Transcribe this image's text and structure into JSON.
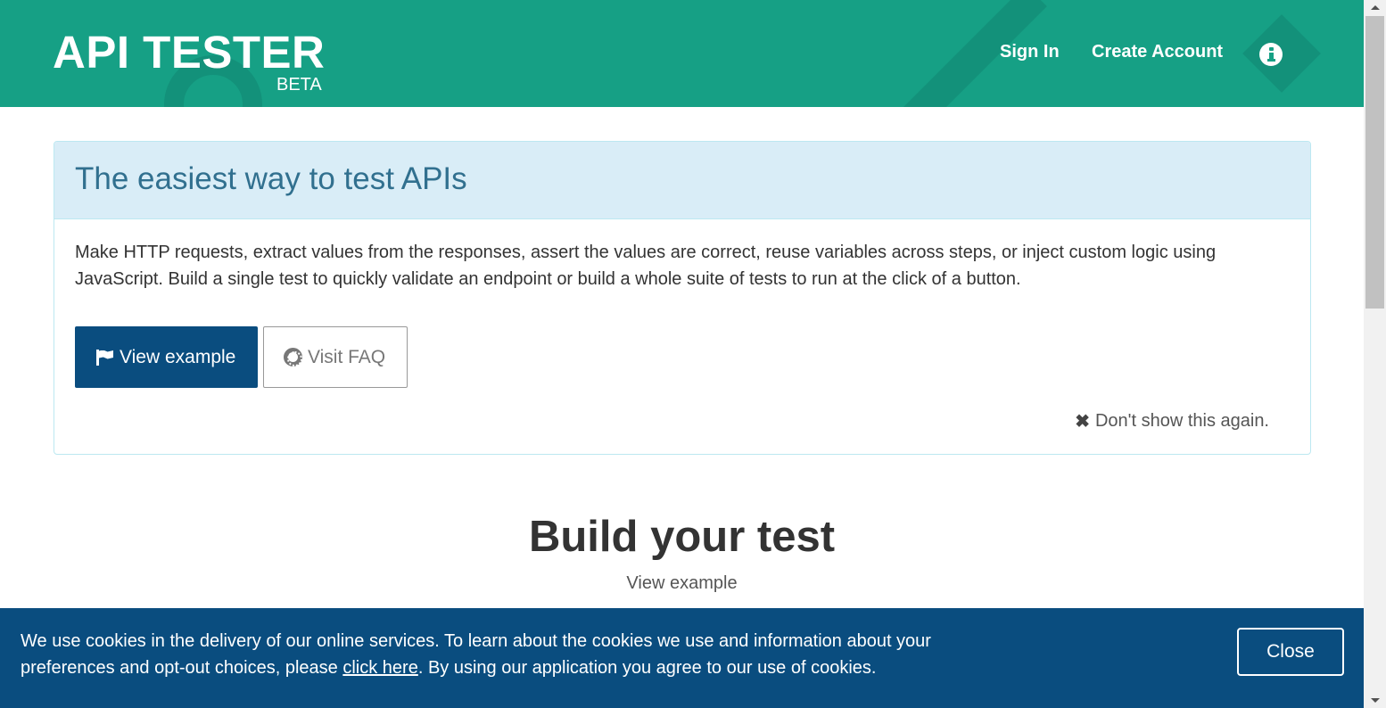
{
  "header": {
    "brand_title": "API TESTER",
    "brand_badge": "BETA",
    "nav": {
      "sign_in": "Sign In",
      "create_account": "Create Account"
    },
    "info_icon": "info-circle-icon",
    "background_color": "#16a085"
  },
  "intro": {
    "title": "The easiest way to test APIs",
    "description": "Make HTTP requests, extract values from the responses, assert the values are correct, reuse variables across steps, or inject custom logic using JavaScript. Build a single test to quickly validate an endpoint or build a whole suite of tests to run at the click of a button.",
    "view_example_label": "View example",
    "view_example_icon": "flag-icon",
    "visit_faq_label": "Visit FAQ",
    "visit_faq_icon": "life-ring-icon",
    "dismiss_label": "Don't show this again.",
    "dismiss_icon": "close-icon",
    "heading_color": "#d9edf7",
    "title_color": "#31708f",
    "primary_color": "#0a4d7f"
  },
  "build": {
    "title": "Build your test",
    "subtitle": "View example"
  },
  "cookie": {
    "text_before": "We use cookies in the delivery of our online services. To learn about the cookies we use and information about your preferences and opt-out choices, please ",
    "link_text": "click here",
    "text_after": ". By using our application you agree to our use of cookies.",
    "close_label": "Close",
    "background_color": "#0a4d7f"
  }
}
